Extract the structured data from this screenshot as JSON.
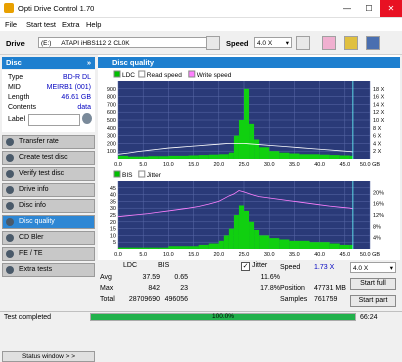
{
  "window": {
    "title": "Opti Drive Control 1.70",
    "minimize": "—",
    "maximize": "☐",
    "close": "✕"
  },
  "menu": [
    "File",
    "Start test",
    "Extra",
    "Help"
  ],
  "toolbar": {
    "drive_label": "Drive",
    "drive_letter": "(E:)",
    "drive_name": "ATAPI iHBS112  2 CL0K",
    "speed_label": "Speed",
    "speed_value": "4.0 X"
  },
  "disc": {
    "header": "Disc",
    "type_label": "Type",
    "type_value": "BD-R DL",
    "mid_label": "MID",
    "mid_value": "MEIRB1 (001)",
    "length_label": "Length",
    "length_value": "46.61 GB",
    "contents_label": "Contents",
    "contents_value": "data",
    "label_label": "Label",
    "label_value": ""
  },
  "nav": [
    {
      "label": "Transfer rate",
      "active": false
    },
    {
      "label": "Create test disc",
      "active": false
    },
    {
      "label": "Verify test disc",
      "active": false
    },
    {
      "label": "Drive info",
      "active": false
    },
    {
      "label": "Disc info",
      "active": false
    },
    {
      "label": "Disc quality",
      "active": true
    },
    {
      "label": "CD Bler",
      "active": false
    },
    {
      "label": "FE / TE",
      "active": false
    },
    {
      "label": "Extra tests",
      "active": false
    }
  ],
  "status_window_button": "Status window > >",
  "panel_title": "Disc quality",
  "chart_data": [
    {
      "type": "area",
      "legend": [
        "LDC",
        "Read speed",
        "Write speed"
      ],
      "legend_colors": [
        "#00c000",
        "#ffffff",
        "#ff80ff"
      ],
      "x_ticks": [
        "0.0",
        "5.0",
        "10.0",
        "15.0",
        "20.0",
        "25.0",
        "30.0",
        "35.0",
        "40.0",
        "45.0",
        "50.0 GB"
      ],
      "y_left_ticks": [
        100,
        200,
        300,
        400,
        500,
        600,
        700,
        800,
        900
      ],
      "y_right_ticks": [
        "2 X",
        "4 X",
        "6 X",
        "8 X",
        "10 X",
        "12 X",
        "14 X",
        "16 X",
        "18 X"
      ],
      "xlim": [
        0,
        50
      ],
      "ylim": [
        0,
        1000
      ],
      "x": [
        0,
        2,
        4,
        6,
        8,
        10,
        12,
        14,
        16,
        18,
        20,
        22,
        23,
        24,
        25,
        26,
        27,
        28,
        30,
        32,
        34,
        36,
        38,
        40,
        42,
        44,
        46,
        46.6
      ],
      "values": [
        40,
        30,
        30,
        35,
        35,
        40,
        40,
        45,
        50,
        55,
        60,
        80,
        300,
        500,
        900,
        450,
        250,
        150,
        100,
        80,
        70,
        60,
        60,
        55,
        50,
        45,
        40,
        30
      ],
      "read_speed": [
        1.2,
        1.5,
        1.9,
        2.2,
        2.5,
        2.8,
        3.0,
        3.2,
        3.4,
        3.6,
        3.8,
        4.0,
        4.0,
        4.0,
        4.0,
        3.9,
        3.8,
        3.7,
        3.5,
        3.3,
        3.1,
        2.9,
        2.7,
        2.5,
        2.3,
        2.1,
        1.9,
        1.8
      ]
    },
    {
      "type": "area",
      "legend": [
        "BIS",
        "Jitter"
      ],
      "legend_colors": [
        "#00c000",
        "#ffffff"
      ],
      "x_ticks": [
        "0.0",
        "5.0",
        "10.0",
        "15.0",
        "20.0",
        "25.0",
        "30.0",
        "35.0",
        "40.0",
        "45.0",
        "50.0 GB"
      ],
      "y_left_ticks": [
        5,
        10,
        15,
        20,
        25,
        30,
        35,
        40,
        45
      ],
      "y_right_ticks": [
        "4%",
        "8%",
        "12%",
        "16%",
        "20%"
      ],
      "xlim": [
        0,
        50
      ],
      "ylim": [
        0,
        50
      ],
      "x": [
        0,
        2,
        4,
        6,
        8,
        10,
        12,
        14,
        16,
        18,
        20,
        21,
        22,
        23,
        24,
        25,
        26,
        27,
        28,
        30,
        32,
        34,
        36,
        38,
        40,
        42,
        44,
        46,
        46.6
      ],
      "values": [
        1,
        1,
        1,
        1,
        1,
        2,
        2,
        2,
        3,
        4,
        6,
        10,
        15,
        25,
        32,
        28,
        20,
        14,
        10,
        8,
        7,
        6,
        6,
        5,
        5,
        4,
        3,
        3,
        2
      ],
      "jitter": [
        9.5,
        9.8,
        10.1,
        10.4,
        10.8,
        11.2,
        11.6,
        12.0,
        12.5,
        13.2,
        14.0,
        14.8,
        15.6,
        16.2,
        17.2,
        16.8,
        16.3,
        15.8,
        15.4,
        15.0,
        14.6,
        14.2,
        13.8,
        13.4,
        13.0,
        12.6,
        12.3,
        12.0,
        11.8
      ]
    }
  ],
  "stats": {
    "col_ldc": "LDC",
    "col_bis": "BIS",
    "avg_label": "Avg",
    "avg_ldc": "37.59",
    "avg_bis": "0.65",
    "max_label": "Max",
    "max_ldc": "842",
    "max_bis": "23",
    "total_label": "Total",
    "total_ldc": "28709690",
    "total_bis": "496056",
    "jitter_label": "Jitter",
    "jitter_avg": "11.6%",
    "jitter_max": "17.8%",
    "speed_label": "Speed",
    "speed_value": "1.73 X",
    "position_label": "Position",
    "position_value": "47731 MB",
    "samples_label": "Samples",
    "samples_value": "761759",
    "speed_select": "4.0 X",
    "start_full": "Start full",
    "start_part": "Start part"
  },
  "statusbar": {
    "text": "Test completed",
    "progress": 1.0,
    "progress_text": "100.0%",
    "time": "66:24"
  }
}
